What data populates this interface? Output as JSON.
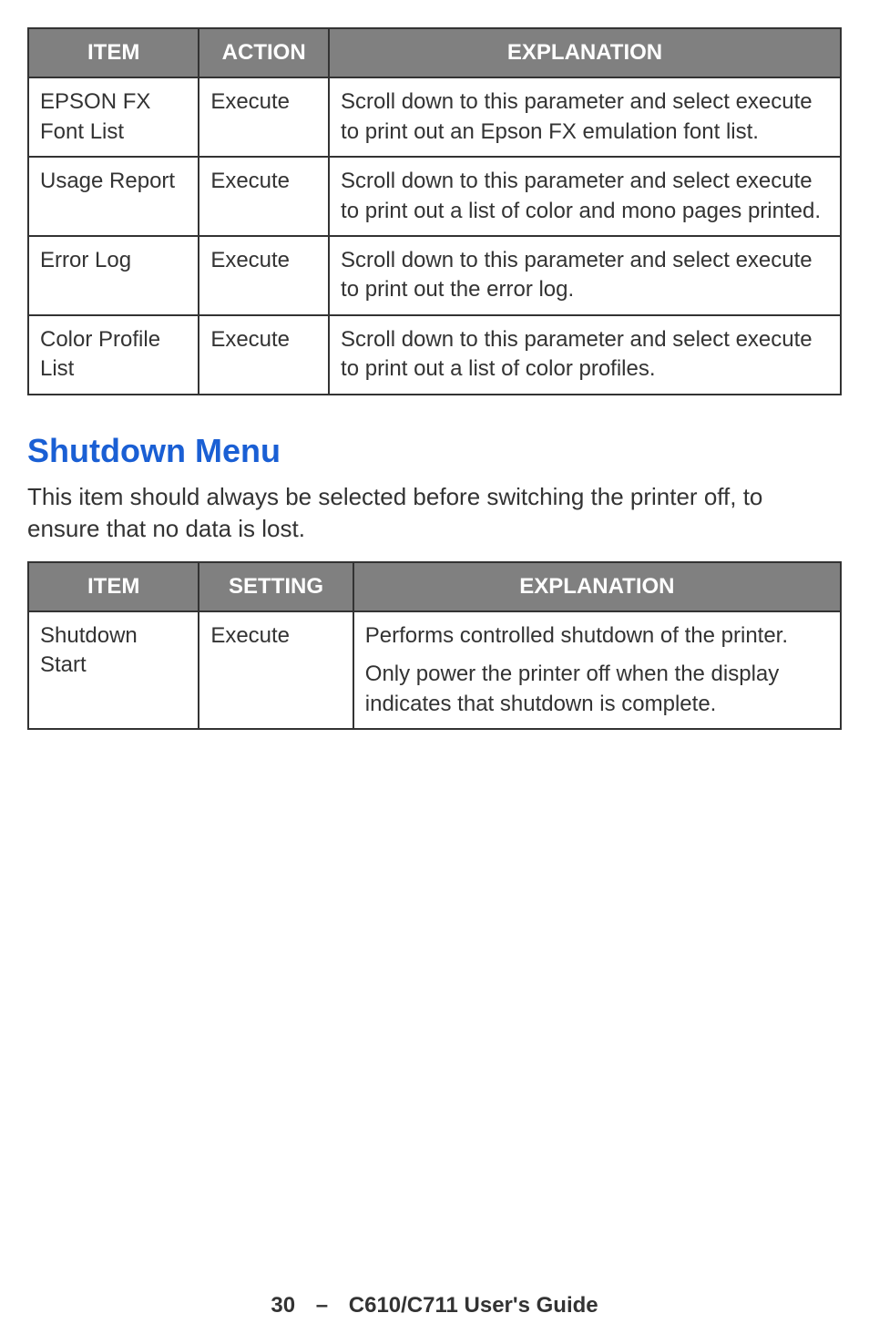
{
  "table1": {
    "headers": {
      "item": "ITEM",
      "action": "ACTION",
      "explanation": "EXPLANATION"
    },
    "rows": [
      {
        "item": "EPSON FX Font List",
        "action": "Execute",
        "explanation": "Scroll down to this parameter and select execute to print out an Epson FX emulation font list."
      },
      {
        "item": "Usage Report",
        "action": "Execute",
        "explanation": "Scroll down to this parameter and select execute to print out a list of color and mono pages printed."
      },
      {
        "item": "Error Log",
        "action": "Execute",
        "explanation": "Scroll down to this parameter and select execute to print out the error log."
      },
      {
        "item": "Color Profile List",
        "action": "Execute",
        "explanation": "Scroll down to this parameter and select execute to print out a list of color profiles."
      }
    ]
  },
  "section": {
    "heading": "Shutdown Menu",
    "description": "This item should always be selected before switching the printer off, to ensure that no data is lost."
  },
  "table2": {
    "headers": {
      "item": "ITEM",
      "setting": "SETTING",
      "explanation": "EXPLANATION"
    },
    "rows": [
      {
        "item": "Shutdown Start",
        "setting": "Execute",
        "explanation_p1": "Performs controlled shutdown of the printer.",
        "explanation_p2": "Only power the printer off when the display indicates that shutdown is complete."
      }
    ]
  },
  "footer": {
    "page": "30",
    "dash": "–",
    "title": "C610/C711 User's Guide"
  }
}
